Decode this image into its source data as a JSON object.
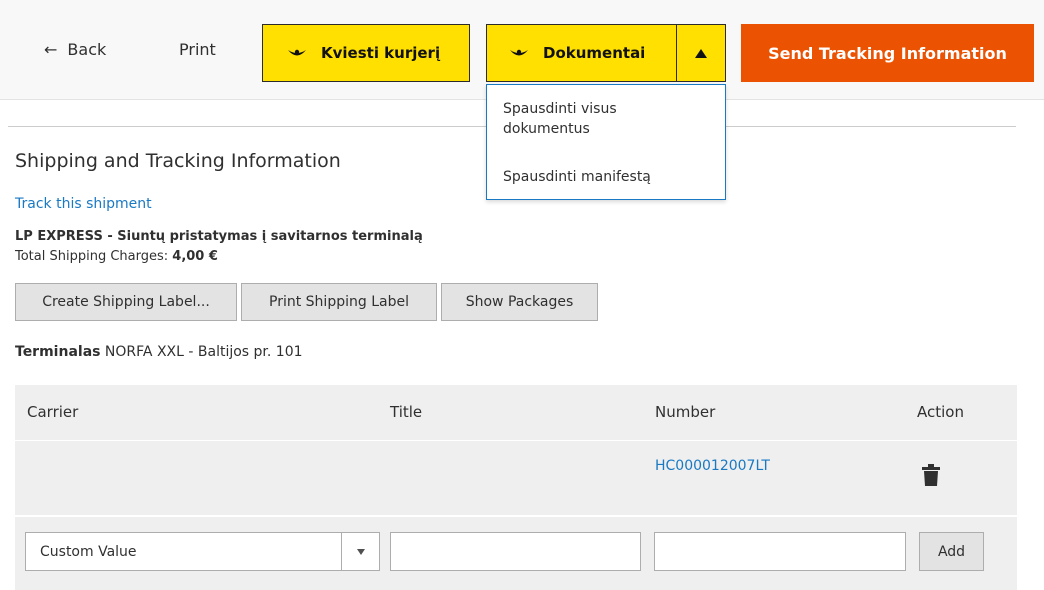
{
  "toolbar": {
    "back_label": "Back",
    "back_icon": "←",
    "print_label": "Print",
    "courier_label": "Kviesti kurjerį",
    "documents_label": "Dokumentai",
    "send_tracking_label": "Send Tracking Information",
    "accent_yellow": "#ffe000",
    "accent_orange": "#eb5202"
  },
  "documents_menu": {
    "items": [
      "Spausdinti visus dokumentus",
      "Spausdinti manifestą"
    ]
  },
  "shipping": {
    "title": "Shipping and Tracking Information",
    "track_link": "Track this shipment",
    "carrier_name": "LP EXPRESS - Siuntų pristatymas į savitarnos terminalą",
    "charges_label": "Total Shipping Charges: ",
    "charges_value": "4,00 €",
    "buttons": {
      "create_label": "Create Shipping Label...",
      "print_label": "Print Shipping Label",
      "packages_label": "Show Packages"
    },
    "terminal_label": "Terminalas",
    "terminal_value": " NORFA XXL - Baltijos pr. 101"
  },
  "tracking_table": {
    "headers": {
      "carrier": "Carrier",
      "title": "Title",
      "number": "Number",
      "action": "Action"
    },
    "rows": [
      {
        "carrier": "",
        "title": "",
        "number": "HC000012007LT",
        "action_icon": "trash-icon"
      }
    ],
    "new_row": {
      "carrier_selected": "Custom Value",
      "title_value": "",
      "number_value": "",
      "add_label": "Add"
    }
  }
}
